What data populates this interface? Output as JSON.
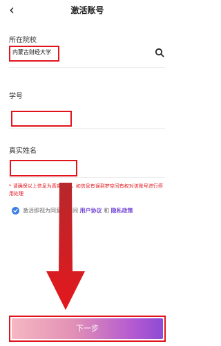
{
  "header": {
    "title": "激活账号",
    "back_icon": "chevron-left-icon"
  },
  "form": {
    "school_label": "所在院校",
    "school_value": "内蒙古财经大学",
    "student_id_label": "学号",
    "student_id_value": "",
    "real_name_label": "真实姓名",
    "real_name_value": ""
  },
  "notice": "* 请确保以上信息为真实信息，如信息有误到梦空间有权对该账号进行停用处理",
  "agreement": {
    "prefix": "激活即视为同意梦空间",
    "user_agreement": "用户协议",
    "and": "和",
    "privacy_policy": "隐私政策"
  },
  "next_button": "下一步",
  "colors": {
    "annotation_red": "#e1141c",
    "link_purple": "#7448d6",
    "check_blue": "#3c7de6",
    "button_gradient": [
      "#f6b7c3",
      "#e291b5",
      "#b45ad1",
      "#8d4bd4"
    ]
  }
}
